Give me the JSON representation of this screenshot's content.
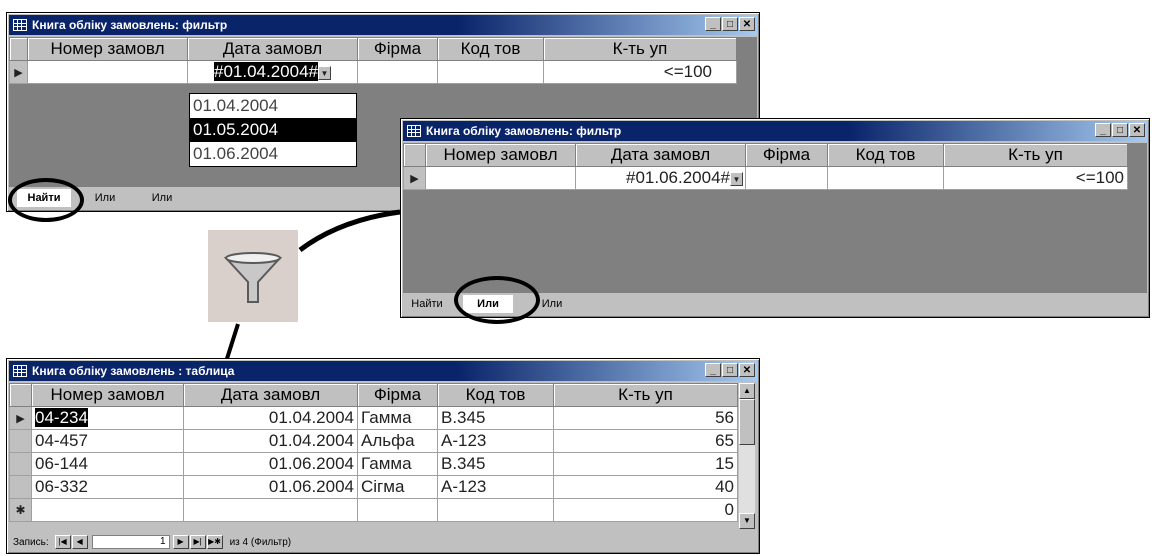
{
  "window1": {
    "title": "Книга обліку замовлень: фильтр",
    "columns": [
      "Номер замовл",
      "Дата замовл",
      "Фірма",
      "Код тов",
      "К-ть уп"
    ],
    "row": {
      "date": "#01.04.2004#",
      "qty": "<=100"
    },
    "dropdown": [
      "01.04.2004",
      "01.05.2004",
      "01.06.2004"
    ],
    "dropdown_selected": "01.05.2004",
    "tabs": [
      "Найти",
      "Или",
      "Или"
    ]
  },
  "window2": {
    "title": "Книга обліку замовлень: фильтр",
    "columns": [
      "Номер замовл",
      "Дата замовл",
      "Фірма",
      "Код тов",
      "К-ть уп"
    ],
    "row": {
      "date": "#01.06.2004#",
      "qty": "<=100"
    },
    "tabs": [
      "Найти",
      "Или",
      "Или"
    ]
  },
  "window3": {
    "title": "Книга обліку замовлень : таблица",
    "columns": [
      "Номер замовл",
      "Дата замовл",
      "Фірма",
      "Код тов",
      "К-ть уп"
    ],
    "rows": [
      {
        "num": "04-234",
        "date": "01.04.2004",
        "firm": "Гамма",
        "code": "В.345",
        "qty": "56"
      },
      {
        "num": "04-457",
        "date": "01.04.2004",
        "firm": "Альфа",
        "code": "А-123",
        "qty": "65"
      },
      {
        "num": "06-144",
        "date": "01.06.2004",
        "firm": "Гамма",
        "code": "В.345",
        "qty": "15"
      },
      {
        "num": "06-332",
        "date": "01.06.2004",
        "firm": "Сігма",
        "code": "А-123",
        "qty": "40"
      }
    ],
    "new_row_qty": "0",
    "nav": {
      "label": "Запись:",
      "record": "1",
      "of_text": "из 4 (Фильтр)"
    }
  },
  "icons": {
    "filter": "funnel-icon"
  }
}
